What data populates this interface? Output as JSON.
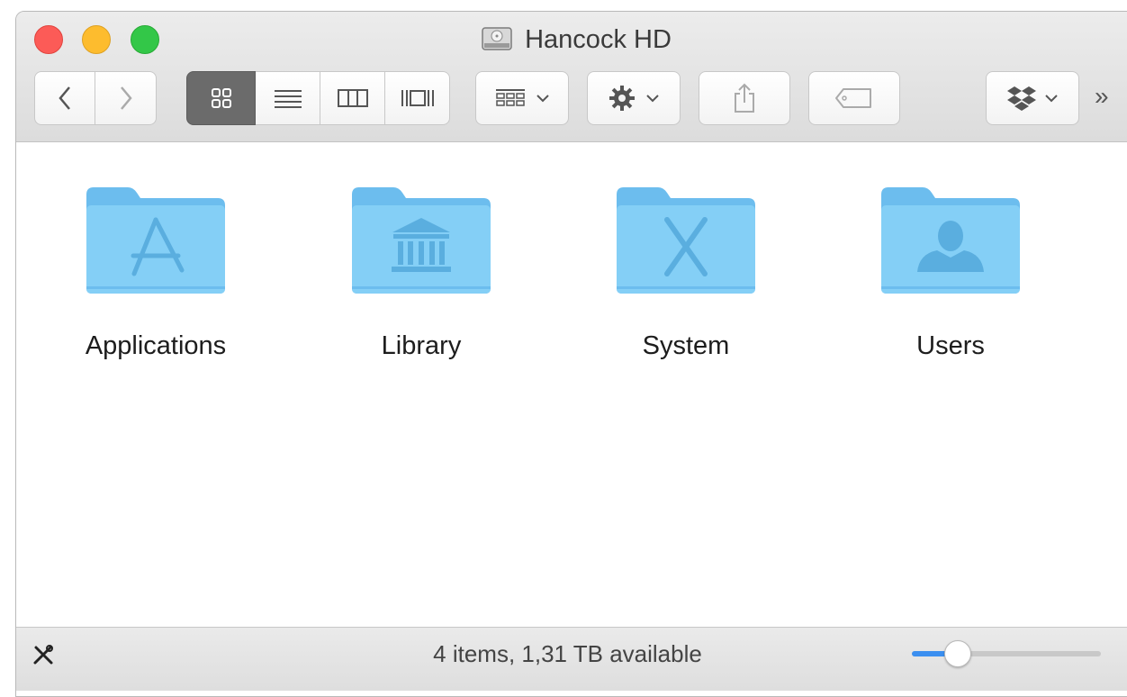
{
  "window": {
    "title": "Hancock HD"
  },
  "toolbar": {
    "more_label": "»"
  },
  "items": [
    {
      "label": "Applications",
      "glyph": "app-store-icon"
    },
    {
      "label": "Library",
      "glyph": "library-columns-icon"
    },
    {
      "label": "System",
      "glyph": "system-x-icon"
    },
    {
      "label": "Users",
      "glyph": "user-silhouette-icon"
    }
  ],
  "status": {
    "text": "4 items, 1,31 TB available",
    "zoom_fraction": 0.24
  },
  "colors": {
    "folder": "#7fcaf3",
    "folder_dark": "#5fb4e6",
    "accent": "#3b8ff0"
  }
}
